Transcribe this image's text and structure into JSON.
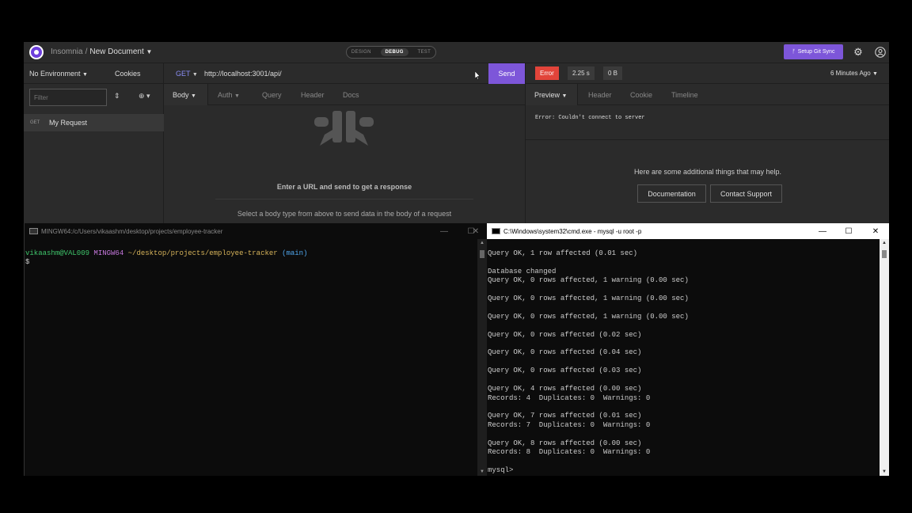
{
  "insomnia": {
    "breadcrumb": {
      "app": "Insomnia",
      "separator": "/",
      "document": "New Document"
    },
    "modes": [
      "DESIGN",
      "DEBUG",
      "TEST"
    ],
    "git_sync": "Setup Git Sync",
    "sidebar": {
      "environment": "No Environment",
      "cookies": "Cookies",
      "filter_placeholder": "Filter",
      "requests": [
        {
          "method": "GET",
          "name": "My Request"
        }
      ]
    },
    "request": {
      "method": "GET",
      "url": "http://localhost:3001/api/",
      "send": "Send",
      "tabs": [
        "Body",
        "Auth",
        "Query",
        "Header",
        "Docs"
      ],
      "empty_message": "Enter a URL and send to get a response",
      "body_hint": "Select a body type from above to send data in the body of a request"
    },
    "response": {
      "status": "Error",
      "time": "2.25 s",
      "size": "0 B",
      "ago": "6 Minutes Ago",
      "tabs": [
        "Preview",
        "Header",
        "Cookie",
        "Timeline"
      ],
      "error": "Error: Couldn't connect to server",
      "help_text": "Here are some additional things that may help.",
      "documentation": "Documentation",
      "contact_support": "Contact Support"
    },
    "colors": {
      "accent": "#7d56d9",
      "error": "#e2443a"
    }
  },
  "git_terminal": {
    "title": "MINGW64:/c/Users/vikaashm/desktop/projects/employee-tracker",
    "user": "vikaashm@VAL009",
    "shell": "MINGW64",
    "path": "~/desktop/projects/employee-tracker",
    "branch": "(main)",
    "prompt": "$"
  },
  "cmd_terminal": {
    "title": "C:\\Windows\\system32\\cmd.exe - mysql  -u root -p",
    "output": "Query OK, 1 row affected (0.01 sec)\n\nDatabase changed\nQuery OK, 0 rows affected, 1 warning (0.00 sec)\n\nQuery OK, 0 rows affected, 1 warning (0.00 sec)\n\nQuery OK, 0 rows affected, 1 warning (0.00 sec)\n\nQuery OK, 0 rows affected (0.02 sec)\n\nQuery OK, 0 rows affected (0.04 sec)\n\nQuery OK, 0 rows affected (0.03 sec)\n\nQuery OK, 4 rows affected (0.00 sec)\nRecords: 4  Duplicates: 0  Warnings: 0\n\nQuery OK, 7 rows affected (0.01 sec)\nRecords: 7  Duplicates: 0  Warnings: 0\n\nQuery OK, 8 rows affected (0.00 sec)\nRecords: 8  Duplicates: 0  Warnings: 0\n\nmysql>"
  }
}
